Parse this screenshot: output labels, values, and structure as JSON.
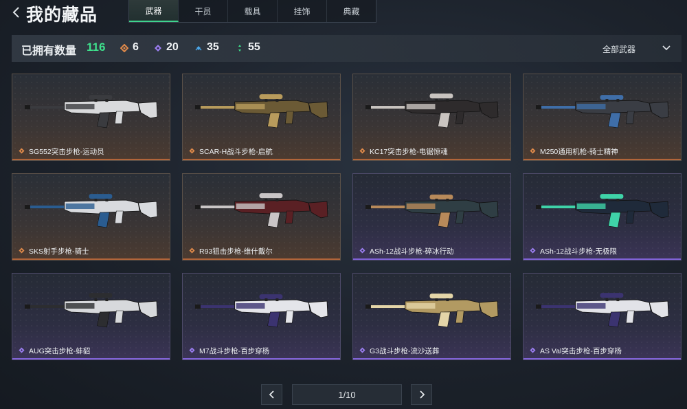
{
  "header": {
    "title": "我的藏品",
    "tabs": [
      {
        "label": "武器",
        "active": true
      },
      {
        "label": "干员",
        "active": false
      },
      {
        "label": "载具",
        "active": false
      },
      {
        "label": "挂饰",
        "active": false
      },
      {
        "label": "典藏",
        "active": false
      }
    ]
  },
  "stats": {
    "owned_label": "已拥有数量",
    "owned_count": "116",
    "counts": [
      {
        "icon": "orange-rarity-icon",
        "value": "6",
        "color": "#e08a4a"
      },
      {
        "icon": "purple-rarity-icon",
        "value": "20",
        "color": "#9b7ef0"
      },
      {
        "icon": "blue-rarity-icon",
        "value": "35",
        "color": "#4aa6e8"
      },
      {
        "icon": "green-rarity-icon",
        "value": "55",
        "color": "#3ee08c"
      }
    ],
    "filter_label": "全部武器"
  },
  "items": [
    {
      "name": "SG552突击步枪-运动员",
      "rarity": "orange",
      "gun_color": "#d9dadc",
      "accent": "#3a3b3f"
    },
    {
      "name": "SCAR-H战斗步枪-启航",
      "rarity": "orange",
      "gun_color": "#6b5a35",
      "accent": "#b89b5c"
    },
    {
      "name": "KC17突击步枪-电锯惊魂",
      "rarity": "orange",
      "gun_color": "#2e2b2c",
      "accent": "#c9c4c0"
    },
    {
      "name": "M250通用机枪-骑士精神",
      "rarity": "orange",
      "gun_color": "#3a3d44",
      "accent": "#3f6ea8"
    },
    {
      "name": "SKS射手步枪-骑士",
      "rarity": "orange",
      "gun_color": "#d8dade",
      "accent": "#2a5c90"
    },
    {
      "name": "R93狙击步枪-维什戴尔",
      "rarity": "orange",
      "gun_color": "#5a2024",
      "accent": "#c9c5c6"
    },
    {
      "name": "ASh-12战斗步枪-碎冰行动",
      "rarity": "purple",
      "gun_color": "#2f3e44",
      "accent": "#b88a5a"
    },
    {
      "name": "ASh-12战斗步枪-无极限",
      "rarity": "purple",
      "gun_color": "#1f2a3a",
      "accent": "#3fd3a8"
    },
    {
      "name": "AUG突击步枪-蚌貂",
      "rarity": "purple",
      "gun_color": "#d7d9dc",
      "accent": "#2c2d30"
    },
    {
      "name": "M7战斗步枪-百步穿杨",
      "rarity": "purple",
      "gun_color": "#e4e5ea",
      "accent": "#3b3370"
    },
    {
      "name": "G3战斗步枪-流沙送葬",
      "rarity": "purple",
      "gun_color": "#b29a62",
      "accent": "#e4d5a8"
    },
    {
      "name": "AS Val突击步枪-百步穿杨",
      "rarity": "purple",
      "gun_color": "#e2e3e8",
      "accent": "#3b3370"
    }
  ],
  "pager": {
    "label": "1/10"
  }
}
